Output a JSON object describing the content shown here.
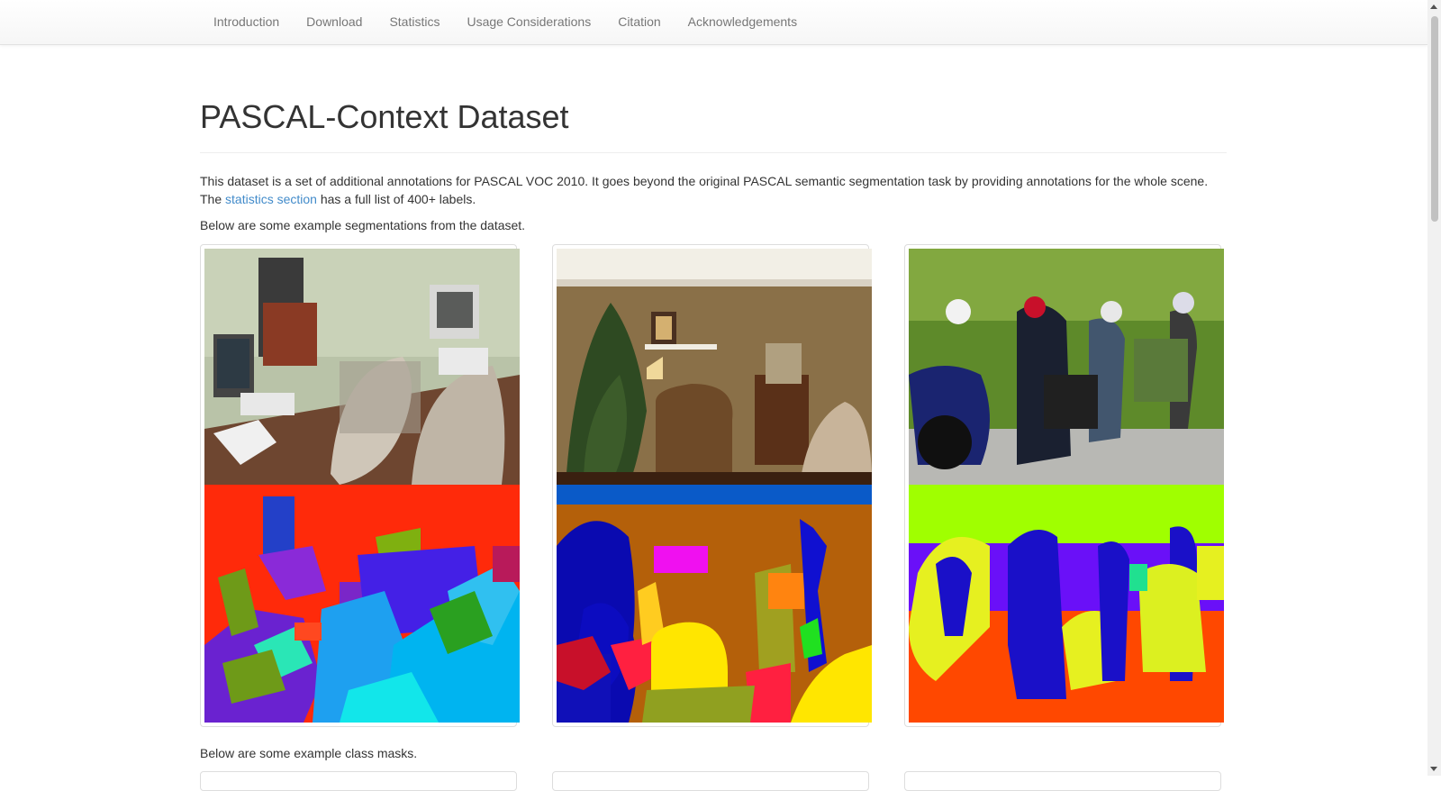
{
  "nav": {
    "items": [
      {
        "label": "Introduction"
      },
      {
        "label": "Download"
      },
      {
        "label": "Statistics"
      },
      {
        "label": "Usage Considerations"
      },
      {
        "label": "Citation"
      },
      {
        "label": "Acknowledgements"
      }
    ]
  },
  "main": {
    "title": "PASCAL-Context Dataset",
    "intro_text": "This dataset is a set of additional annotations for PASCAL VOC 2010. It goes beyond the original PASCAL semantic segmentation task by providing annotations for the whole scene. The ",
    "intro_link": "statistics section",
    "intro_suffix": " has a full list of 400+ labels.",
    "examples_heading": "Below are some example segmentations from the dataset.",
    "class_masks_heading": "Below are some example class masks."
  },
  "colors": {
    "link": "#428bca",
    "nav_text": "#777777",
    "body_text": "#333333"
  }
}
